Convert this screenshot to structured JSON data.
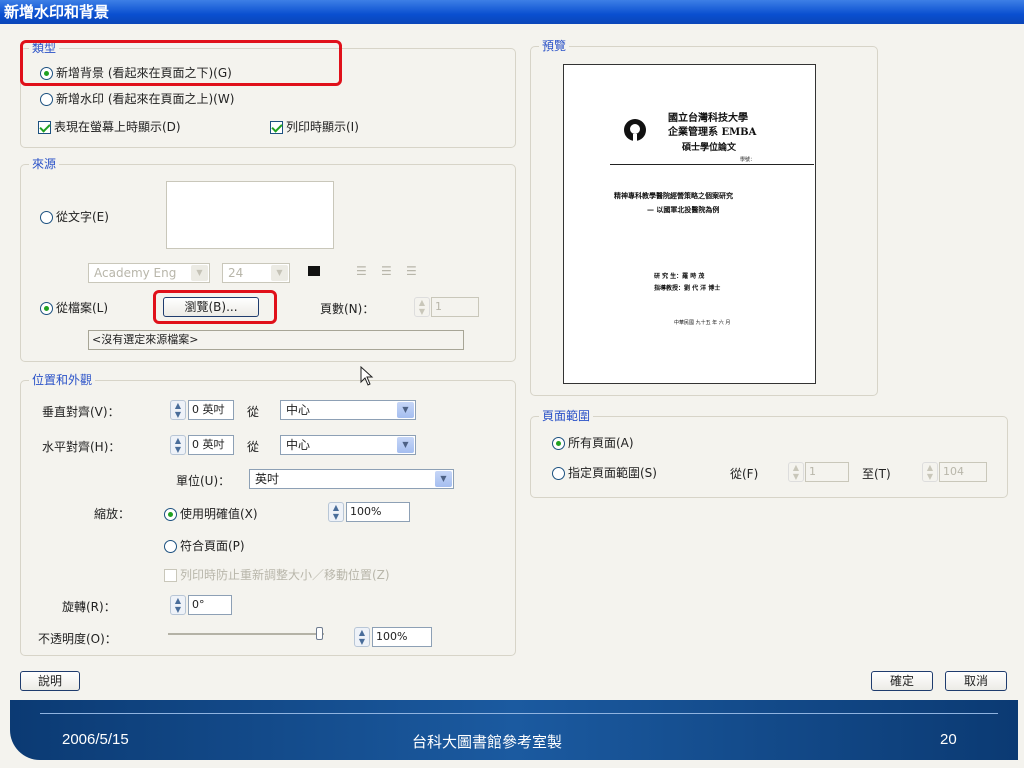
{
  "dialog": {
    "title": "新增水印和背景"
  },
  "type_group": {
    "title": "類型",
    "add_background": "新增背景 (看起來在頁面之下)(G)",
    "add_watermark": "新增水印 (看起來在頁面之上)(W)",
    "show_on_screen": "表現在螢幕上時顯示(D)",
    "show_on_print": "列印時顯示(I)"
  },
  "source_group": {
    "title": "來源",
    "from_text": "從文字(E)",
    "font_name": "Academy Eng",
    "font_size": "24",
    "from_file": "從檔案(L)",
    "browse": "瀏覽(B)...",
    "pages_label": "頁數(N)：",
    "pages_value": "1",
    "file_status": "<沒有選定來源檔案>"
  },
  "position_group": {
    "title": "位置和外觀",
    "vertical_label": "垂直對齊(V)：",
    "vertical_value": "0 英吋",
    "from1": "從",
    "vertical_select": "中心",
    "horizontal_label": "水平對齊(H)：",
    "horizontal_value": "0 英吋",
    "from2": "從",
    "horizontal_select": "中心",
    "unit_label": "單位(U)：",
    "unit_value": "英吋",
    "scale_label": "縮放：",
    "explicit_value": "使用明確值(X)",
    "scale_value": "100%",
    "fit_page": "符合頁面(P)",
    "prevent_resize": "列印時防止重新調整大小／移動位置(Z)",
    "rotation_label": "旋轉(R)：",
    "rotation_value": "0°",
    "opacity_label": "不透明度(O)：",
    "opacity_value": "100%",
    "opacity_level": 1.0
  },
  "preview": {
    "title": "預覽",
    "school_line1": "國立台灣科技大學",
    "school_line2": "企業管理系 EMBA",
    "thesis": "碩士學位論文",
    "student_id": "學號：",
    "topic1": "精神專科教學醫院經營策略之個案研究",
    "topic2": "— 以國軍北投醫院為例",
    "author": "研 究 生：羅 時 茂",
    "advisor": "指導教授：劉 代 洋 博士",
    "date": "中華民國 九十五 年 六 月"
  },
  "page_range_group": {
    "title": "頁面範圍",
    "all_pages": "所有頁面(A)",
    "specified": "指定頁面範圍(S)",
    "from": "從(F)",
    "from_value": "1",
    "to": "至(T)",
    "to_value": "104"
  },
  "buttons": {
    "help": "說明",
    "ok": "確定",
    "cancel": "取消"
  },
  "footer": {
    "date": "2006/5/15",
    "center": "台科大圖書館參考室製",
    "page": "20"
  }
}
